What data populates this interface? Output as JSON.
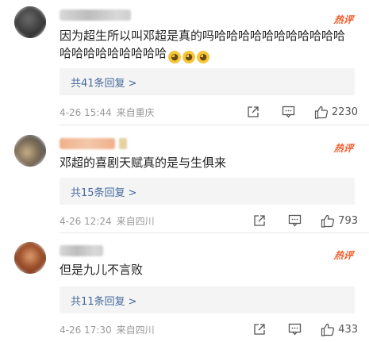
{
  "comments": [
    {
      "username": "blurred-user-1",
      "hot_label": "热评",
      "text": "因为超生所以叫邓超是真的吗哈哈哈哈哈哈哈哈哈哈哈哈哈哈哈哈哈哈哈哈",
      "emoji_count": 3,
      "reply_label": "共41条回复",
      "reply_arrow": ">",
      "time": "4-26 15:44",
      "source": "来自重庆",
      "likes": "2230"
    },
    {
      "username": "blurred-user-2",
      "hot_label": "热评",
      "text": "邓超的喜剧天赋真的是与生俱来",
      "reply_label": "共15条回复",
      "reply_arrow": ">",
      "time": "4-26 12:24",
      "source": "来自四川",
      "likes": "793"
    },
    {
      "username": "blurred-user-3",
      "hot_label": "热评",
      "text": "但是九儿不言败",
      "reply_label": "共11条回复",
      "reply_arrow": ">",
      "time": "4-26 17:30",
      "source": "来自四川",
      "likes": "433"
    }
  ],
  "colors": {
    "hot": "#f05a28",
    "reply_link": "#466b9e",
    "meta": "#999999"
  },
  "icons": [
    "share-icon",
    "comment-icon",
    "like-icon",
    "laughing-emoji-icon"
  ]
}
